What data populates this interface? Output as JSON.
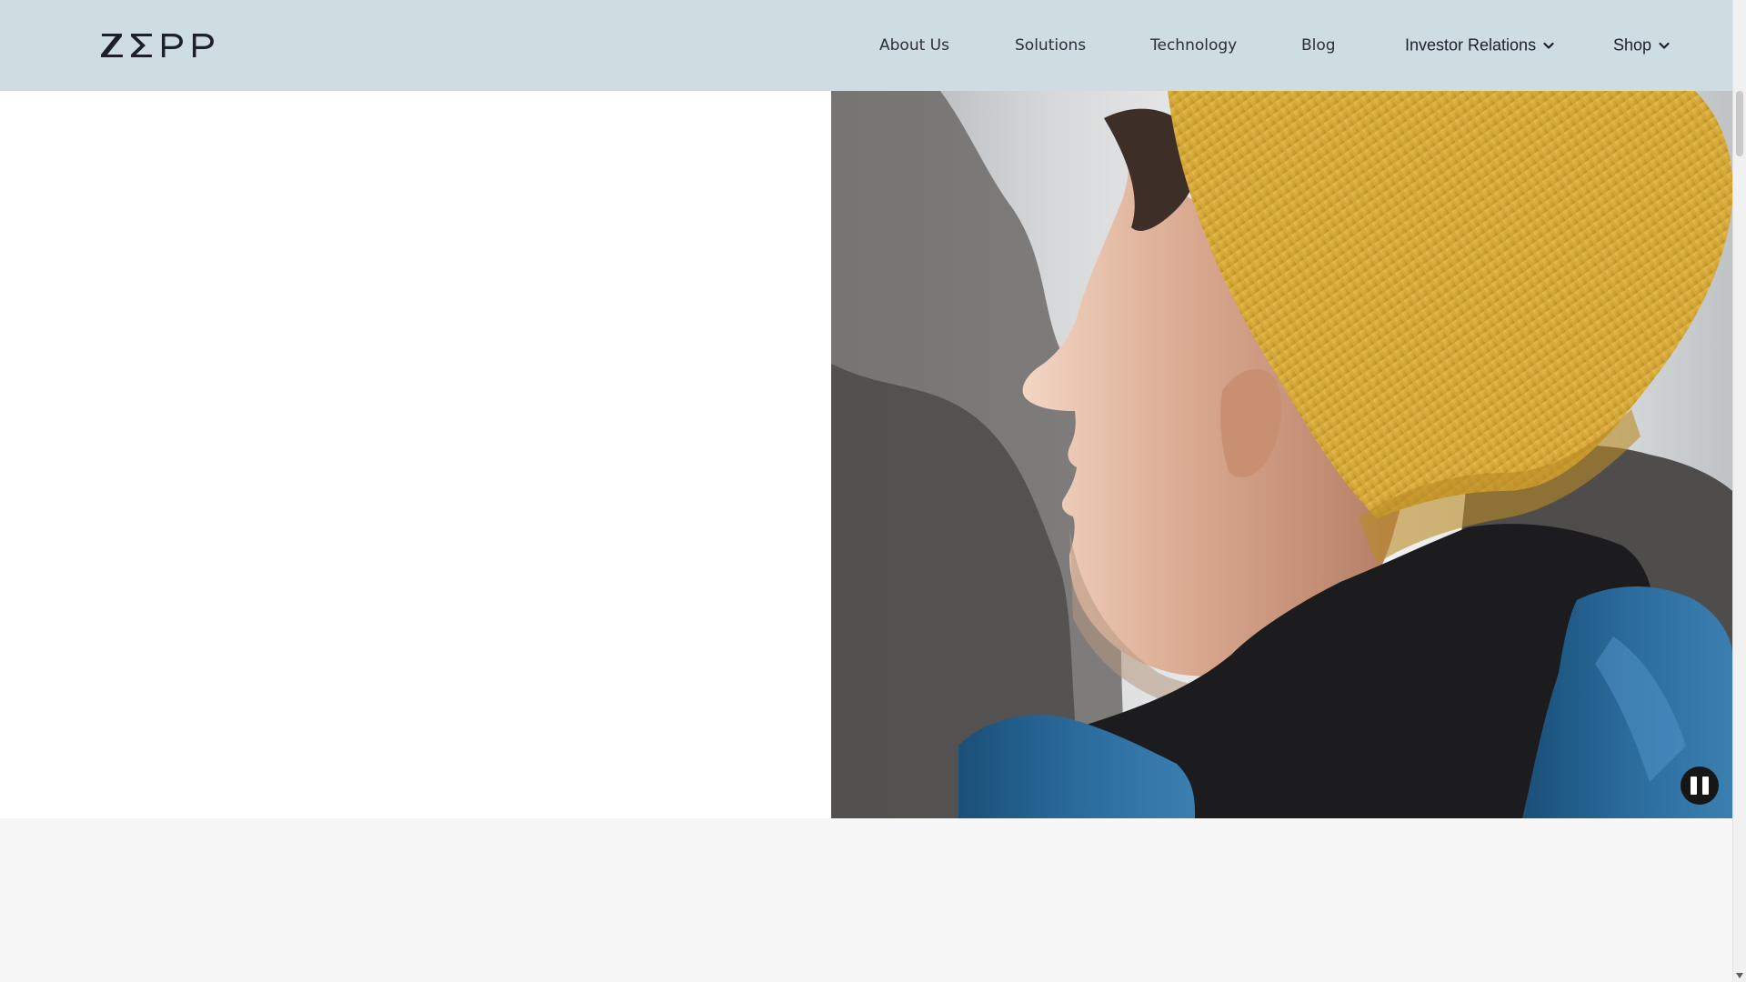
{
  "header": {
    "logo_text": "ZEPP",
    "nav": {
      "about": "About Us",
      "solutions": "Solutions",
      "technology": "Technology",
      "blog": "Blog",
      "investor_relations": "Investor Relations",
      "shop": "Shop"
    }
  },
  "hero": {
    "video_subject": "man in yellow knit beanie and blue jacket facing left against a mountain backdrop",
    "pause_icon": "pause-icon"
  },
  "colors": {
    "header_bg": "#cddde1",
    "nav_text": "#1d1f2a",
    "hero_left_bg": "#ffffff",
    "lower_band_bg": "#f7f7f7",
    "beanie": "#d7ad3a",
    "jacket": "#1f5e8d",
    "pause_button_bg": "#161616"
  }
}
